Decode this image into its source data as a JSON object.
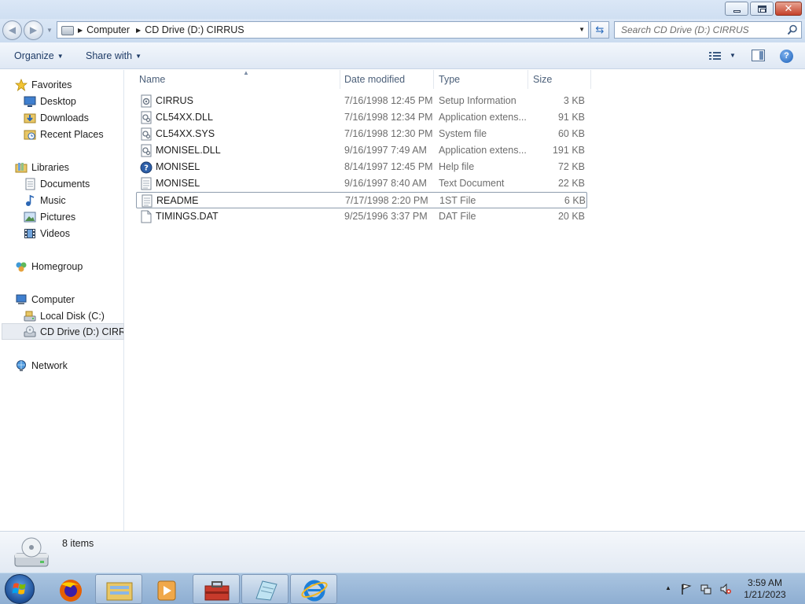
{
  "window": {
    "minimize_icon": "minimize-icon",
    "maximize_icon": "restore-icon",
    "close_icon": "close-icon"
  },
  "address": {
    "crumbs": [
      "Computer",
      "CD Drive (D:) CIRRUS"
    ],
    "separator_icon": "chevron-right-icon"
  },
  "search": {
    "placeholder": "Search CD Drive (D:) CIRRUS"
  },
  "toolbar": {
    "organize_label": "Organize",
    "share_label": "Share with"
  },
  "sidebar": {
    "favorites": {
      "label": "Favorites",
      "items": [
        {
          "label": "Desktop"
        },
        {
          "label": "Downloads"
        },
        {
          "label": "Recent Places"
        }
      ]
    },
    "libraries": {
      "label": "Libraries",
      "items": [
        {
          "label": "Documents"
        },
        {
          "label": "Music"
        },
        {
          "label": "Pictures"
        },
        {
          "label": "Videos"
        }
      ]
    },
    "homegroup": {
      "label": "Homegroup"
    },
    "computer": {
      "label": "Computer",
      "items": [
        {
          "label": "Local Disk (C:)"
        },
        {
          "label": "CD Drive (D:) CIRRUS"
        }
      ]
    },
    "network": {
      "label": "Network"
    }
  },
  "columns": {
    "name": "Name",
    "date": "Date modified",
    "type": "Type",
    "size": "Size"
  },
  "files": [
    {
      "name": "CIRRUS",
      "date": "7/16/1998 12:45 PM",
      "type": "Setup Information",
      "size": "3 KB",
      "icon": "setup-info-icon"
    },
    {
      "name": "CL54XX.DLL",
      "date": "7/16/1998 12:34 PM",
      "type": "Application extens...",
      "size": "91 KB",
      "icon": "dll-file-icon"
    },
    {
      "name": "CL54XX.SYS",
      "date": "7/16/1998 12:30 PM",
      "type": "System file",
      "size": "60 KB",
      "icon": "system-file-icon"
    },
    {
      "name": "MONISEL.DLL",
      "date": "9/16/1997 7:49 AM",
      "type": "Application extens...",
      "size": "191 KB",
      "icon": "dll-file-icon"
    },
    {
      "name": "MONISEL",
      "date": "8/14/1997 12:45 PM",
      "type": "Help file",
      "size": "72 KB",
      "icon": "help-file-icon"
    },
    {
      "name": "MONISEL",
      "date": "9/16/1997 8:40 AM",
      "type": "Text Document",
      "size": "22 KB",
      "icon": "text-document-icon"
    },
    {
      "name": "README",
      "date": "7/17/1998 2:20 PM",
      "type": "1ST File",
      "size": "6 KB",
      "icon": "text-document-icon"
    },
    {
      "name": "TIMINGS.DAT",
      "date": "9/25/1996 3:37 PM",
      "type": "DAT File",
      "size": "20 KB",
      "icon": "blank-file-icon"
    }
  ],
  "details": {
    "count": "8 items"
  },
  "taskbar": {
    "time": "3:59 AM",
    "date": "1/21/2023"
  },
  "colors": {
    "accent": "#1e3b66",
    "selection": "#e8ecf2",
    "taskbar": "#9cb8d9"
  }
}
